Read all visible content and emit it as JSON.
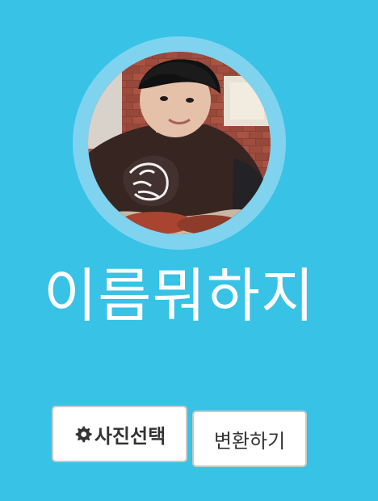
{
  "theme": {
    "background": "#38c2e6",
    "ring": "#7fd3ee"
  },
  "profile": {
    "name": "이름뭐하지"
  },
  "actions": {
    "select_photo_label": "사진선택",
    "select_photo_icon": "gear-icon",
    "convert_label": "변환하기"
  }
}
